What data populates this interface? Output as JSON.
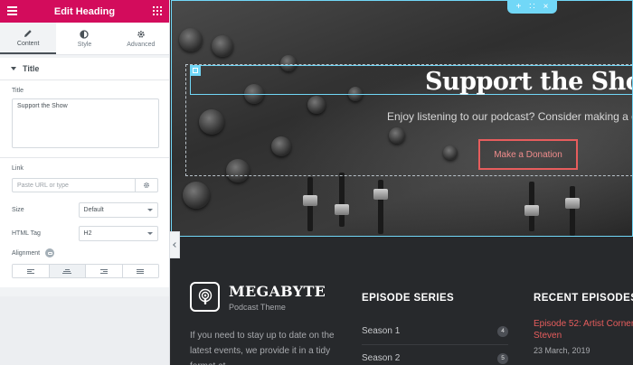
{
  "panel": {
    "title": "Edit Heading",
    "tabs": [
      {
        "label": "Content",
        "icon": "pencil-icon",
        "active": true
      },
      {
        "label": "Style",
        "icon": "half-circle-icon",
        "active": false
      },
      {
        "label": "Advanced",
        "icon": "gear-icon",
        "active": false
      }
    ],
    "section_title": "Title",
    "title_control": {
      "label": "Title",
      "value": "Support the Show"
    },
    "link_control": {
      "label": "Link",
      "placeholder": "Paste URL or type"
    },
    "size_control": {
      "label": "Size",
      "value": "Default"
    },
    "html_tag_control": {
      "label": "HTML Tag",
      "value": "H2"
    },
    "alignment_control": {
      "label": "Alignment",
      "options": [
        "left",
        "center",
        "right",
        "justify"
      ],
      "selected": "center"
    }
  },
  "section_toolbar": {
    "add": "+",
    "move": "∷",
    "close": "×"
  },
  "hero": {
    "heading": "Support the Show",
    "subtitle": "Enjoy listening to our podcast? Consider making a do",
    "button_label": "Make a Donation"
  },
  "footer": {
    "brand_name": "MEGABYTE",
    "brand_tagline": "Podcast Theme",
    "description": "If you need to stay up to date on the latest events, we provide it in a tidy format at",
    "episode_series": {
      "title": "EPISODE SERIES",
      "items": [
        {
          "label": "Season 1",
          "count": "4"
        },
        {
          "label": "Season 2",
          "count": "5"
        }
      ]
    },
    "recent_episodes": {
      "title": "RECENT EPISODES",
      "item_title": "Episode 52: Artist Corner Steven",
      "item_date": "23 March, 2019"
    }
  },
  "colors": {
    "accent": "#d30c5c",
    "selection": "#71d7f7",
    "donate": "#e75d5d"
  }
}
